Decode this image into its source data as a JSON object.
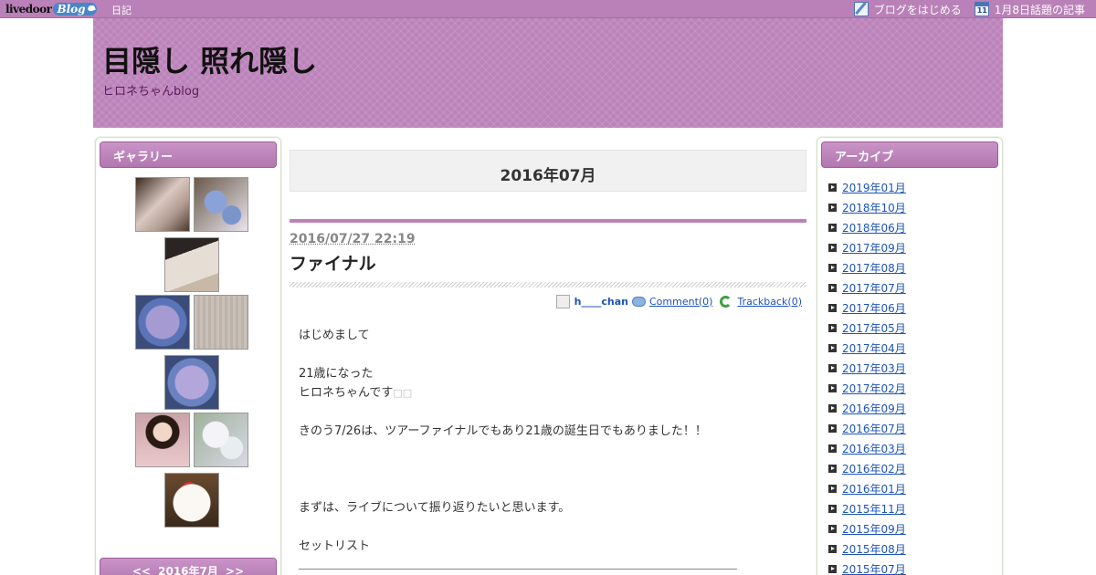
{
  "topbar": {
    "logo_text": "livedoor",
    "logo_blog": "Blog",
    "diary_link": "日記",
    "start_blog": "ブログをはじめる",
    "calendar_day": "11",
    "topic_link": "1月8日話題の記事"
  },
  "header": {
    "title": "目隠し 照れ隠し",
    "subtitle": "ヒロネちゃんblog"
  },
  "left_sidebar": {
    "gallery_title": "ギャラリー",
    "calendar_nav": "<<   2016年7月   >>"
  },
  "main": {
    "month_heading": "2016年07月",
    "post": {
      "date": "2016/07/27 22:19",
      "title": "ファイナル",
      "author": "h____chan",
      "comment_link": "Comment(0)",
      "trackback_link": "Trackback(0)",
      "lines": [
        "はじめまして",
        "",
        "21歳になった",
        "ヒロネちゃんです",
        "",
        "きのう7/26は、ツアーファイナルでもあり21歳の誕生日でもありました！！",
        "",
        "",
        "",
        "まずは、ライブについて振り返りたいと思います。",
        "",
        "セットリスト"
      ],
      "tofu": "□□"
    }
  },
  "right_sidebar": {
    "archive_title": "アーカイブ",
    "archive_items": [
      "2019年01月",
      "2018年10月",
      "2018年06月",
      "2017年09月",
      "2017年08月",
      "2017年07月",
      "2017年06月",
      "2017年05月",
      "2017年04月",
      "2017年03月",
      "2017年02月",
      "2016年09月",
      "2016年07月",
      "2016年03月",
      "2016年02月",
      "2016年01月",
      "2015年11月",
      "2015年09月",
      "2015年08月",
      "2015年07月"
    ]
  },
  "colors": {
    "accent": "#bb83ba",
    "topbar": "#b981b7",
    "link": "#1d54b8"
  }
}
